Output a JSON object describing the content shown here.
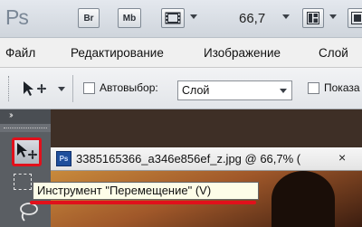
{
  "appbar": {
    "logo": "Ps",
    "buttons": [
      "Br",
      "Mb"
    ],
    "zoom": "66,7"
  },
  "menu": {
    "items": [
      "Файл",
      "Редактирование",
      "Изображение",
      "Слой"
    ]
  },
  "options": {
    "autoselect_label": "Автовыбор:",
    "autoselect_value": "Слой",
    "show_label": "Показа"
  },
  "document": {
    "icon": "Ps",
    "title": "3385165366_a346e856ef_z.jpg @ 66,7% (",
    "close": "×"
  },
  "tooltip": {
    "text": "Инструмент \"Перемещение\" (V)"
  },
  "tools": {
    "collapse": "››"
  },
  "colors": {
    "highlight": "#e1101b",
    "tooltip_bg": "#fdfde8"
  }
}
